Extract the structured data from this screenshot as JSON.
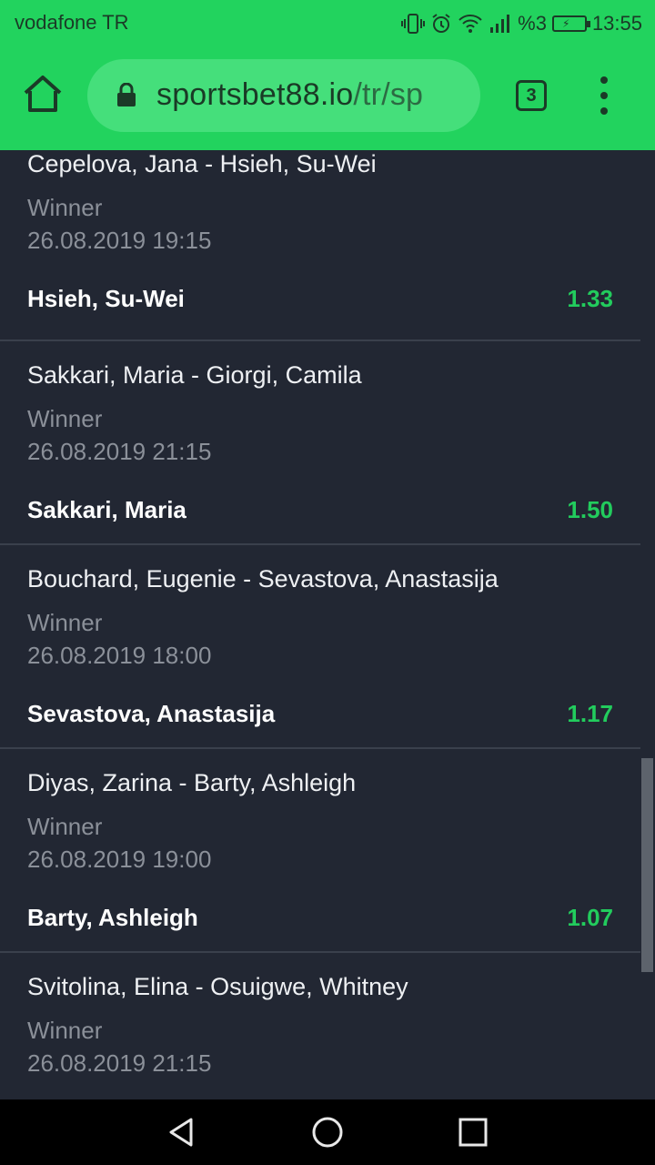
{
  "status_bar": {
    "carrier": "vodafone TR",
    "battery": "%3",
    "time": "13:55",
    "icons": [
      "vibrate-icon",
      "alarm-icon",
      "wifi-icon",
      "signal-icon",
      "battery-icon"
    ]
  },
  "browser": {
    "url_host": "sportsbet88.io",
    "url_path": "/tr/sp",
    "tab_count": "3"
  },
  "bets": [
    {
      "match": "Cepelova, Jana - Hsieh, Su-Wei",
      "market": "Winner",
      "date": "26.08.2019 19:15",
      "selection": "Hsieh, Su-Wei",
      "odds": "1.33"
    },
    {
      "match": "Sakkari, Maria - Giorgi, Camila",
      "market": "Winner",
      "date": "26.08.2019 21:15",
      "selection": "Sakkari, Maria",
      "odds": "1.50"
    },
    {
      "match": "Bouchard, Eugenie - Sevastova, Anastasija",
      "market": "Winner",
      "date": "26.08.2019 18:00",
      "selection": "Sevastova, Anastasija",
      "odds": "1.17"
    },
    {
      "match": "Diyas, Zarina - Barty, Ashleigh",
      "market": "Winner",
      "date": "26.08.2019 19:00",
      "selection": "Barty, Ashleigh",
      "odds": "1.07"
    },
    {
      "match": "Svitolina, Elina - Osuigwe, Whitney",
      "market": "Winner",
      "date": "26.08.2019 21:15"
    }
  ],
  "colors": {
    "accent": "#22d35e",
    "background": "#222733",
    "odds": "#22cc5d"
  }
}
